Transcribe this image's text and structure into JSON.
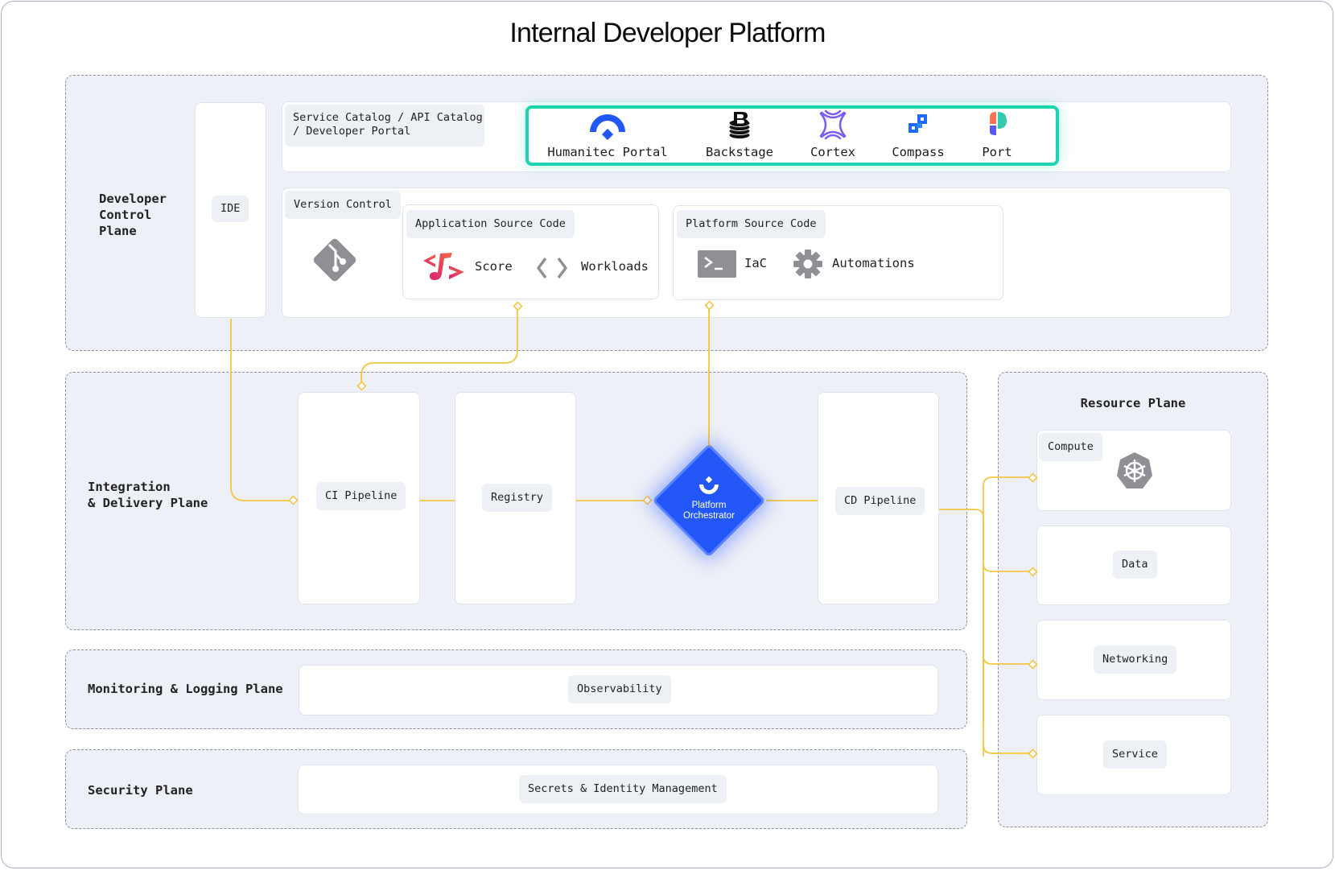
{
  "title": "Internal Developer Platform",
  "colors": {
    "plane_bg": "#edf0f7",
    "connector": "#f5c542",
    "portal_highlight": "#1ed3b1",
    "orchestrator": "#2356f6",
    "icon_gray": "#8e9096"
  },
  "developer_control_plane": {
    "label": "Developer Control Plane",
    "label_lines": [
      "Developer",
      "Control",
      "Plane"
    ],
    "ide": "IDE",
    "catalog": {
      "label_line1": "Service Catalog / API Catalog",
      "label_line2": "/ Developer Portal",
      "tools": [
        {
          "name": "Humanitec Portal",
          "icon": "humanitec-icon"
        },
        {
          "name": "Backstage",
          "icon": "backstage-icon"
        },
        {
          "name": "Cortex",
          "icon": "cortex-icon"
        },
        {
          "name": "Compass",
          "icon": "compass-icon"
        },
        {
          "name": "Port",
          "icon": "port-icon"
        }
      ]
    },
    "version_control": {
      "label": "Version Control",
      "icon": "git-icon",
      "application_source": {
        "label": "Application Source Code",
        "items": [
          {
            "name": "Score",
            "icon": "score-icon"
          },
          {
            "name": "Workloads",
            "icon": "code-brackets-icon"
          }
        ]
      },
      "platform_source": {
        "label": "Platform Source Code",
        "items": [
          {
            "name": "IaC",
            "icon": "terminal-icon"
          },
          {
            "name": "Automations",
            "icon": "gear-icon"
          }
        ]
      }
    }
  },
  "integration_delivery_plane": {
    "label_line1": "Integration",
    "label_line2": "& Delivery Plane",
    "ci": "CI Pipeline",
    "registry": "Registry",
    "orchestrator_line1": "Platform",
    "orchestrator_line2": "Orchestrator",
    "cd": "CD Pipeline"
  },
  "monitoring_plane": {
    "label": "Monitoring & Logging Plane",
    "item": "Observability"
  },
  "security_plane": {
    "label": "Security Plane",
    "item": "Secrets & Identity Management"
  },
  "resource_plane": {
    "label": "Resource Plane",
    "items": [
      {
        "name": "Compute",
        "icon": "kubernetes-icon"
      },
      {
        "name": "Data"
      },
      {
        "name": "Networking"
      },
      {
        "name": "Service"
      }
    ]
  }
}
